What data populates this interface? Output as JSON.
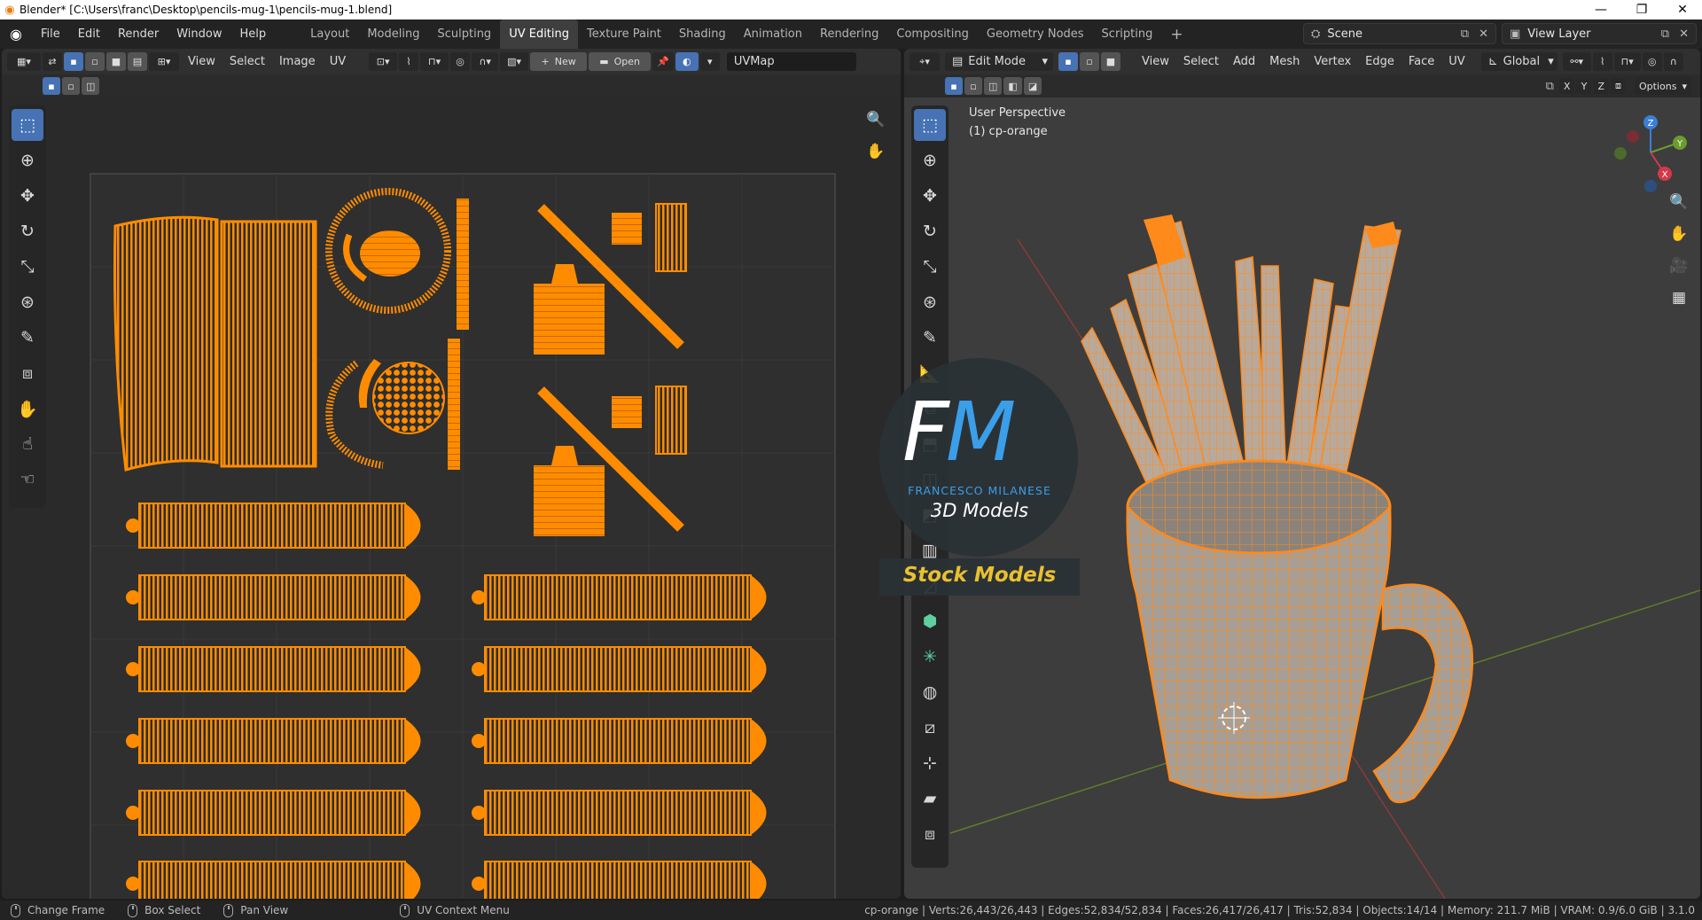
{
  "window": {
    "title": "Blender* [C:\\Users\\franc\\Desktop\\pencils-mug-1\\pencils-mug-1.blend]",
    "controls": {
      "minimize": "—",
      "restore": "❐",
      "close": "✕"
    }
  },
  "menus": [
    "File",
    "Edit",
    "Render",
    "Window",
    "Help"
  ],
  "workspaces": [
    {
      "label": "Layout",
      "active": false
    },
    {
      "label": "Modeling",
      "active": false
    },
    {
      "label": "Sculpting",
      "active": false
    },
    {
      "label": "UV Editing",
      "active": true
    },
    {
      "label": "Texture Paint",
      "active": false
    },
    {
      "label": "Shading",
      "active": false
    },
    {
      "label": "Animation",
      "active": false
    },
    {
      "label": "Rendering",
      "active": false
    },
    {
      "label": "Compositing",
      "active": false
    },
    {
      "label": "Geometry Nodes",
      "active": false
    },
    {
      "label": "Scripting",
      "active": false
    }
  ],
  "add_workspace": "+",
  "scene": {
    "label": "Scene"
  },
  "view_layer": {
    "label": "View Layer"
  },
  "uv_editor": {
    "menus": [
      "View",
      "Select",
      "Image",
      "UV"
    ],
    "new_label": "New",
    "open_label": "Open",
    "uvmap": "UVMap"
  },
  "viewport": {
    "mode": "Edit Mode",
    "menus": [
      "View",
      "Select",
      "Add",
      "Mesh",
      "Vertex",
      "Edge",
      "Face",
      "UV"
    ],
    "orientation": "Global",
    "axes": [
      "X",
      "Y",
      "Z"
    ],
    "options_label": "Options",
    "overlay_line1": "User Perspective",
    "overlay_line2": "(1) cp-orange",
    "gizmo": {
      "x": "X",
      "y": "Y",
      "z": "Z"
    }
  },
  "watermark": {
    "monogram_f": "F",
    "monogram_m": "M",
    "name": "FRANCESCO MILANESE",
    "line": "3D Models",
    "banner": "Stock Models"
  },
  "statusbar": {
    "change_frame": "Change Frame",
    "box_select": "Box Select",
    "pan_view": "Pan View",
    "uv_context": "UV Context Menu",
    "stats": "cp-orange | Verts:26,443/26,443 | Edges:52,834/52,834 | Faces:26,417/26,417 | Tris:52,834 | Objects:14/14 | Memory: 211.7 MiB | VRAM: 0.9/6.0 GiB | 3.1.0"
  },
  "colors": {
    "accent": "#4772b3",
    "uv_orange": "#ff8c00",
    "wire_orange": "#ff8a1c",
    "mesh_gray": "#a79f95",
    "watermark_blue": "#3b9ee8",
    "banner_yellow": "#e9c02f"
  }
}
